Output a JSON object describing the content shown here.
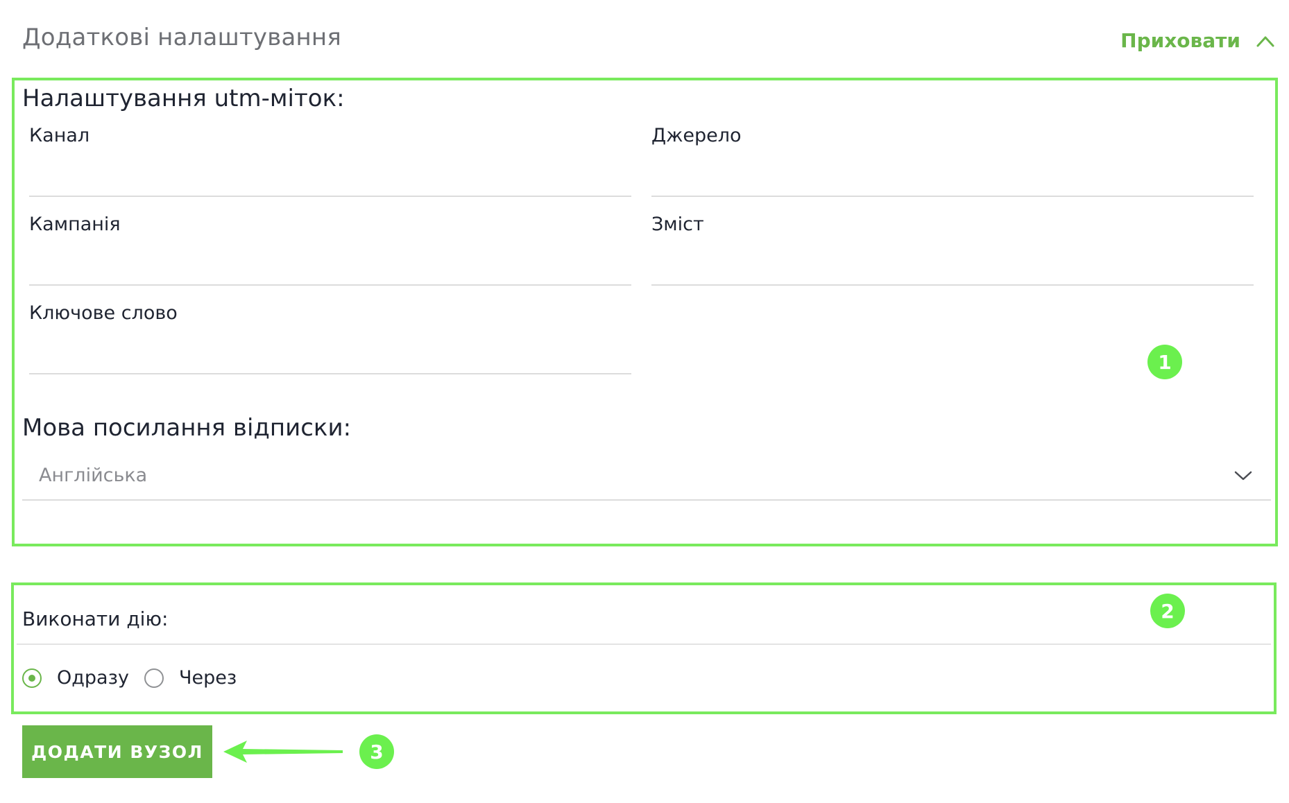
{
  "header": {
    "title": "Додаткові налаштування",
    "toggle_label": "Приховати",
    "toggle_icon": "chevron-up-icon"
  },
  "utm": {
    "title": "Налаштування utm-міток:",
    "fields": {
      "channel": {
        "label": "Канал",
        "value": ""
      },
      "source": {
        "label": "Джерело",
        "value": ""
      },
      "campaign": {
        "label": "Кампанія",
        "value": ""
      },
      "content": {
        "label": "Зміст",
        "value": ""
      },
      "keyword": {
        "label": "Ключове слово",
        "value": ""
      }
    }
  },
  "unsubscribe": {
    "title": "Мова посилання відписки:",
    "selected": "Англійська",
    "icon": "chevron-down-icon"
  },
  "action": {
    "label": "Виконати дію:",
    "options": [
      {
        "label": "Одразу",
        "checked": true
      },
      {
        "label": "Через",
        "checked": false
      }
    ]
  },
  "add_button": {
    "label": "ДОДАТИ ВУЗОЛ"
  },
  "annotations": {
    "badge_1": "1",
    "badge_2": "2",
    "badge_3": "3"
  },
  "colors": {
    "accent": "#6ab64a",
    "highlight": "#79ea5d",
    "badge": "#6bf04e"
  }
}
